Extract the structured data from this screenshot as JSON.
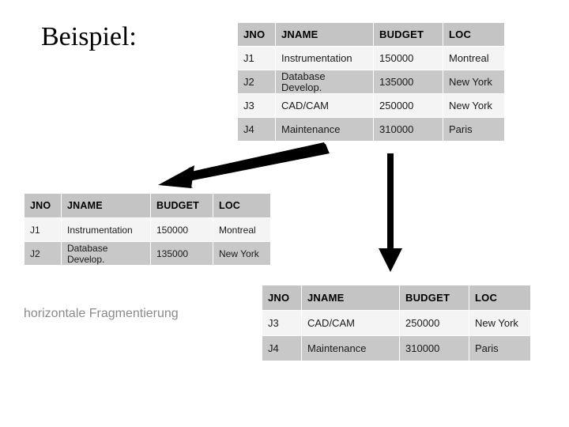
{
  "slide": {
    "title": "Beispiel:",
    "caption": "horizontale Fragmentierung",
    "background_color": "#ffffff",
    "header_color": "#c4c4c4",
    "row_light_color": "#f4f4f4",
    "row_dark_color": "#c8c8c8",
    "caption_color": "#8a8a8a",
    "arrow_color": "#000000"
  },
  "tables": {
    "source": {
      "name": "source-relation",
      "columns": [
        "JNO",
        "JNAME",
        "BUDGET",
        "LOC"
      ],
      "rows": [
        {
          "jno": "J1",
          "jname": "Instrumentation",
          "budget": "150000",
          "loc": "Montreal"
        },
        {
          "jno": "J2",
          "jname": "Database\nDevelop.",
          "budget": "135000",
          "loc": "New York"
        },
        {
          "jno": "J3",
          "jname": "CAD/CAM",
          "budget": "250000",
          "loc": "New York"
        },
        {
          "jno": "J4",
          "jname": "Maintenance",
          "budget": "310000",
          "loc": "Paris"
        }
      ]
    },
    "fragment_1": {
      "name": "fragment-one",
      "columns": [
        "JNO",
        "JNAME",
        "BUDGET",
        "LOC"
      ],
      "rows": [
        {
          "jno": "J1",
          "jname": "Instrumentation",
          "budget": "150000",
          "loc": "Montreal"
        },
        {
          "jno": "J2",
          "jname": "Database\nDevelop.",
          "budget": "135000",
          "loc": "New York"
        }
      ]
    },
    "fragment_2": {
      "name": "fragment-two",
      "columns": [
        "JNO",
        "JNAME",
        "BUDGET",
        "LOC"
      ],
      "rows": [
        {
          "jno": "J3",
          "jname": "CAD/CAM",
          "budget": "250000",
          "loc": "New York"
        },
        {
          "jno": "J4",
          "jname": "Maintenance",
          "budget": "310000",
          "loc": "Paris"
        }
      ]
    }
  },
  "arrows": [
    {
      "name": "arrow-to-fragment-one",
      "direction": "down-left"
    },
    {
      "name": "arrow-to-fragment-two",
      "direction": "down"
    }
  ]
}
